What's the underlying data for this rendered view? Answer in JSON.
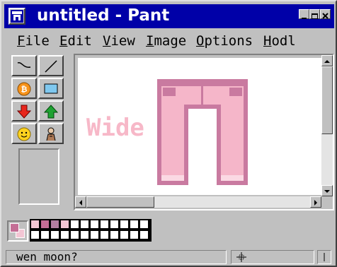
{
  "window": {
    "title": "untitled - Pant",
    "icon": "paint-app-icon",
    "controls": [
      "minimize-icon",
      "maximize-icon",
      "close-icon"
    ]
  },
  "menu": {
    "items": [
      {
        "label": "File",
        "underline": "F",
        "rest": "ile"
      },
      {
        "label": "Edit",
        "underline": "E",
        "rest": "dit"
      },
      {
        "label": "View",
        "underline": "V",
        "rest": "iew"
      },
      {
        "label": "Image",
        "underline": "I",
        "rest": "mage"
      },
      {
        "label": "Options",
        "underline": "O",
        "rest": "ptions"
      },
      {
        "label": "Hodl",
        "underline": "H",
        "rest": "odl"
      }
    ]
  },
  "toolbox": {
    "tools": [
      {
        "name": "curve-tool",
        "icon": "curve-icon"
      },
      {
        "name": "line-tool",
        "icon": "line-icon"
      },
      {
        "name": "bitcoin-tool",
        "icon": "bitcoin-icon"
      },
      {
        "name": "rectangle-tool",
        "icon": "rectangle-icon"
      },
      {
        "name": "down-arrow-tool",
        "icon": "down-arrow-icon"
      },
      {
        "name": "up-arrow-tool",
        "icon": "up-arrow-icon"
      },
      {
        "name": "smiley-tool",
        "icon": "smiley-icon"
      },
      {
        "name": "figure-tool",
        "icon": "figure-icon"
      }
    ]
  },
  "canvas": {
    "text": "Wide",
    "text_color": "#f7b8c8",
    "drawing": "pink-pants"
  },
  "palette": {
    "foreground": "#c46e95",
    "background": "#f3c6d4",
    "colors": [
      "#f3c6d4",
      "#c46e95",
      "#b37ea0",
      "#f3c6d4",
      "#ffffff",
      "#ffffff",
      "#ffffff",
      "#ffffff",
      "#ffffff",
      "#ffffff",
      "#ffffff",
      "#ffffff",
      "#ffffff",
      "#ffffff",
      "#ffffff",
      "#ffffff",
      "#ffffff",
      "#ffffff",
      "#ffffff",
      "#ffffff",
      "#ffffff",
      "#ffffff",
      "#ffffff",
      "#ffffff"
    ]
  },
  "status": {
    "message": "wen moon?",
    "coord_icon": "cursor-position-icon"
  },
  "colors": {
    "titlebar": "#0000a8",
    "face": "#c0c0c0",
    "pants_main": "#f5b6c9",
    "pants_dark": "#c97aa0"
  }
}
